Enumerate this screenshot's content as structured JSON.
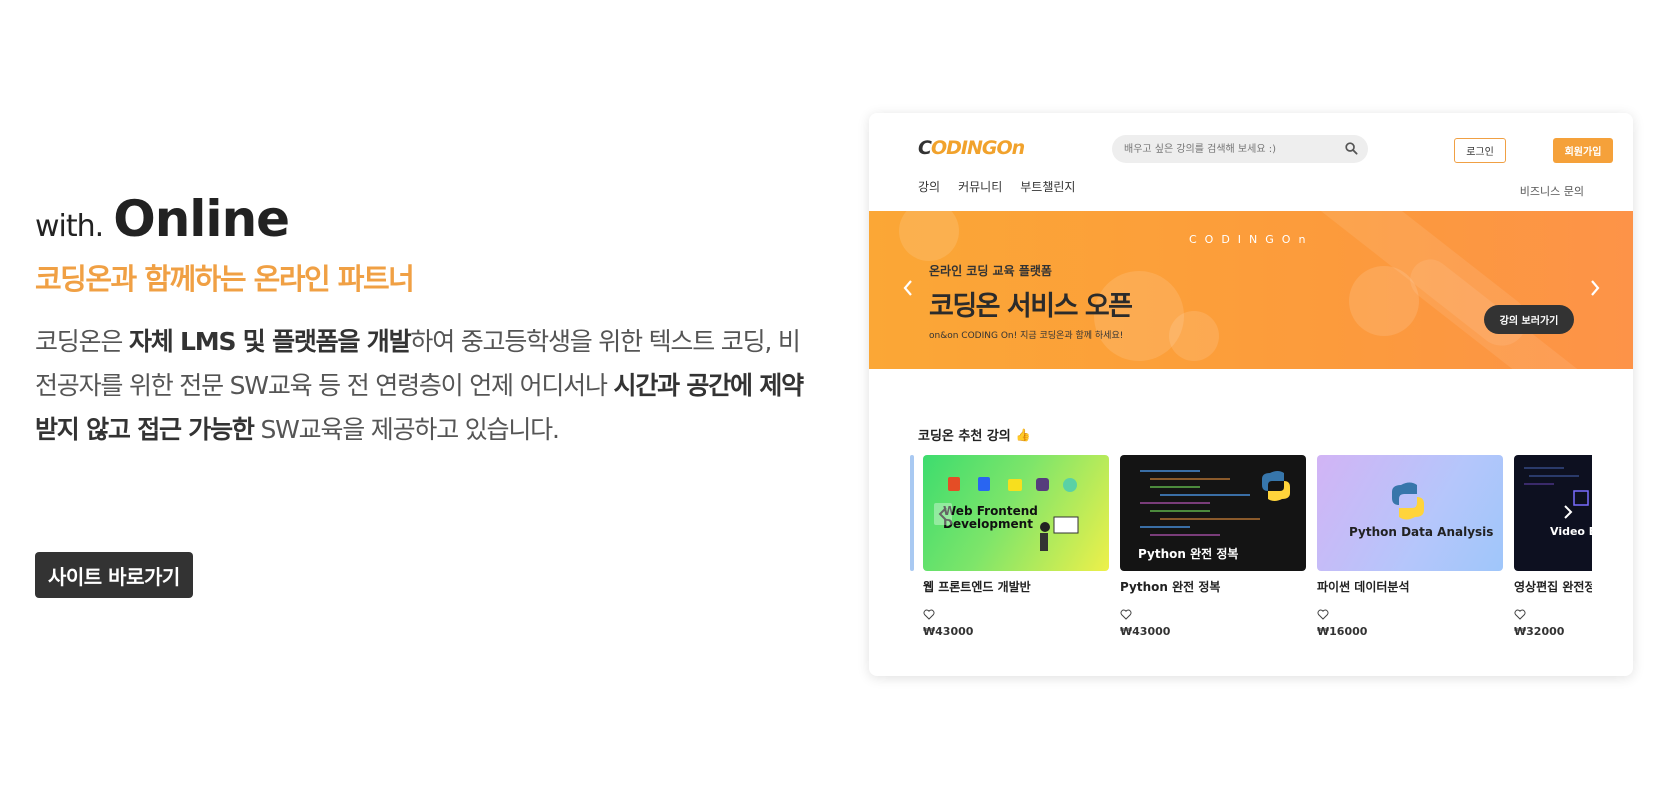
{
  "hero": {
    "with": "with.",
    "online": "Online",
    "subtitle": "코딩온과 함께하는 온라인 파트너",
    "desc": [
      {
        "t": "코딩온은 ",
        "b": false
      },
      {
        "t": "자체 LMS 및 플랫폼을 개발",
        "b": true
      },
      {
        "t": "하여 중고등학생을 위한 텍스트 코딩, 비전공자를 위한 전문 SW교육 등 전 연령층이 언제 어디서나 ",
        "b": false
      },
      {
        "t": "시간과 공간에 제약받지 않고 접근 가능한",
        "b": true
      },
      {
        "t": " SW교육을 제공하고 있습니다.",
        "b": false
      }
    ],
    "button": "사이트 바로가기"
  },
  "mock": {
    "logo_c": "C",
    "logo_rest": "ODINGOn",
    "search_placeholder": "배우고 싶은 강의를 검색해 보세요 :)",
    "login": "로그인",
    "signup": "회원가입",
    "nav": [
      "강의",
      "커뮤니티",
      "부트챌린지"
    ],
    "business": "비즈니스 문의",
    "banner": {
      "brand": "CODINGOn",
      "eyebrow": "온라인 코딩 교육 플랫폼",
      "title": "코딩온 서비스 오픈",
      "sub": "on&on CODING On! 지금 코딩온과 함께 하세요!",
      "cta": "강의 보러가기"
    },
    "recommended_title": "코딩온 추천 강의",
    "recommended_emoji": "👍",
    "courses": [
      {
        "title": "웹 프론트엔드 개발반",
        "price": "₩43000",
        "thumb_text": "Web Frontend Development"
      },
      {
        "title": "Python 완전 정복",
        "price": "₩43000",
        "thumb_text": "Python 완전 정복"
      },
      {
        "title": "파이썬 데이터분석",
        "price": "₩16000",
        "thumb_text": "Python Data Analysis"
      },
      {
        "title": "영상편집 완전정",
        "price": "₩32000",
        "thumb_text": "Video E"
      }
    ]
  }
}
